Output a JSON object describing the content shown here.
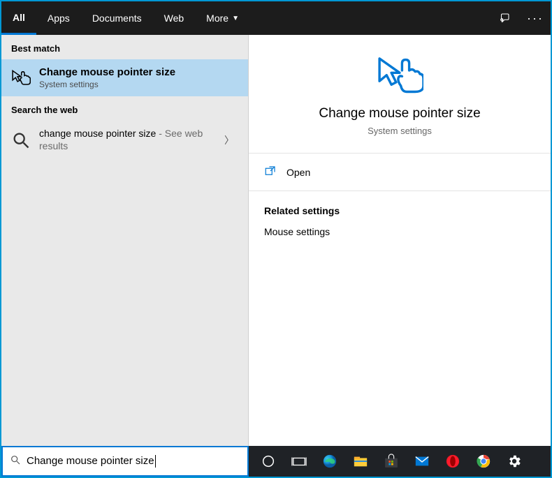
{
  "tabs": {
    "all": "All",
    "apps": "Apps",
    "documents": "Documents",
    "web": "Web",
    "more": "More"
  },
  "left": {
    "best_match_header": "Best match",
    "result1_title": "Change mouse pointer size",
    "result1_sub": "System settings",
    "search_web_header": "Search the web",
    "result2_prefix": "change mouse pointer size",
    "result2_suffix": " - See web results"
  },
  "detail": {
    "title": "Change mouse pointer size",
    "sub": "System settings",
    "open_label": "Open",
    "related_heading": "Related settings",
    "related_item1": "Mouse settings"
  },
  "search": {
    "value": "Change mouse pointer size"
  }
}
